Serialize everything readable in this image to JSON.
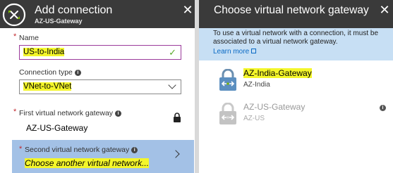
{
  "left": {
    "title": "Add connection",
    "subtitle": "AZ-US-Gateway",
    "icon": "connection-icon",
    "close_icon": "close-icon",
    "name_label": "Name",
    "name_value": "US-to-India",
    "connection_type_label": "Connection type",
    "connection_type_value": "VNet-to-VNet",
    "first_gateway_label": "First virtual network gateway",
    "first_gateway_value": "AZ-US-Gateway",
    "second_gateway_label": "Second virtual network gateway",
    "second_gateway_value": "Choose another virtual network...",
    "required_mark": "*",
    "info_mark": "i"
  },
  "right": {
    "title": "Choose virtual network gateway",
    "close_icon": "close-icon",
    "info_text": "To use a virtual network with a connection, it must be associated to a virtual network gateway.",
    "learn_more": "Learn more",
    "gateways": [
      {
        "name": "AZ-India-Gateway",
        "location": "AZ-India",
        "enabled": true
      },
      {
        "name": "AZ-US-Gateway",
        "location": "AZ-US",
        "enabled": false
      }
    ]
  },
  "colors": {
    "header_bg": "#3a3a3a",
    "highlight": "#f4f62a",
    "selected_row": "#a3c1e6",
    "info_bg": "#c7dff4",
    "link": "#0a6ac4",
    "check": "#5aab2b",
    "required": "#c1282d"
  }
}
